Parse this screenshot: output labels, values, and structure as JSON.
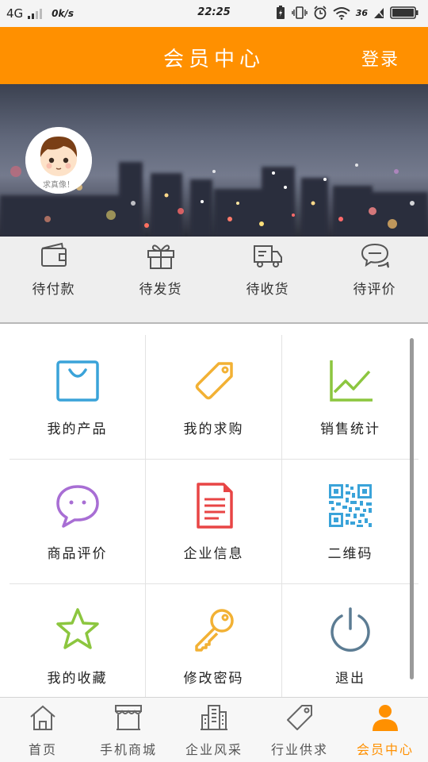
{
  "status_bar": {
    "network": "4G",
    "speed": "0k/s",
    "time": "22:25",
    "signal_label": "36"
  },
  "header": {
    "title": "会员中心",
    "login_label": "登录"
  },
  "profile": {
    "avatar_caption": "求真像！"
  },
  "orders": [
    {
      "label": "待付款",
      "icon": "wallet-icon"
    },
    {
      "label": "待发货",
      "icon": "gift-icon"
    },
    {
      "label": "待收货",
      "icon": "truck-icon"
    },
    {
      "label": "待评价",
      "icon": "chat-bubbles-icon"
    }
  ],
  "grid": [
    {
      "label": "我的产品",
      "icon": "shopping-bag-icon",
      "color": "#3aa3d9"
    },
    {
      "label": "我的求购",
      "icon": "price-tag-icon",
      "color": "#f2b134"
    },
    {
      "label": "销售统计",
      "icon": "line-chart-icon",
      "color": "#8cc63f"
    },
    {
      "label": "商品评价",
      "icon": "speech-bubble-icon",
      "color": "#a86ed4"
    },
    {
      "label": "企业信息",
      "icon": "document-icon",
      "color": "#e84545"
    },
    {
      "label": "二维码",
      "icon": "qr-code-icon",
      "color": "#3aa3d9"
    },
    {
      "label": "我的收藏",
      "icon": "star-icon",
      "color": "#8cc63f"
    },
    {
      "label": "修改密码",
      "icon": "key-icon",
      "color": "#f2b134"
    },
    {
      "label": "退出",
      "icon": "power-icon",
      "color": "#5c7c93"
    }
  ],
  "tabs": [
    {
      "label": "首页",
      "icon": "home-icon",
      "active": false
    },
    {
      "label": "手机商城",
      "icon": "storefront-icon",
      "active": false
    },
    {
      "label": "企业风采",
      "icon": "buildings-icon",
      "active": false
    },
    {
      "label": "行业供求",
      "icon": "tag-icon",
      "active": false
    },
    {
      "label": "会员中心",
      "icon": "user-icon",
      "active": true
    }
  ],
  "colors": {
    "accent": "#ff9000",
    "tab_inactive": "#555555"
  }
}
